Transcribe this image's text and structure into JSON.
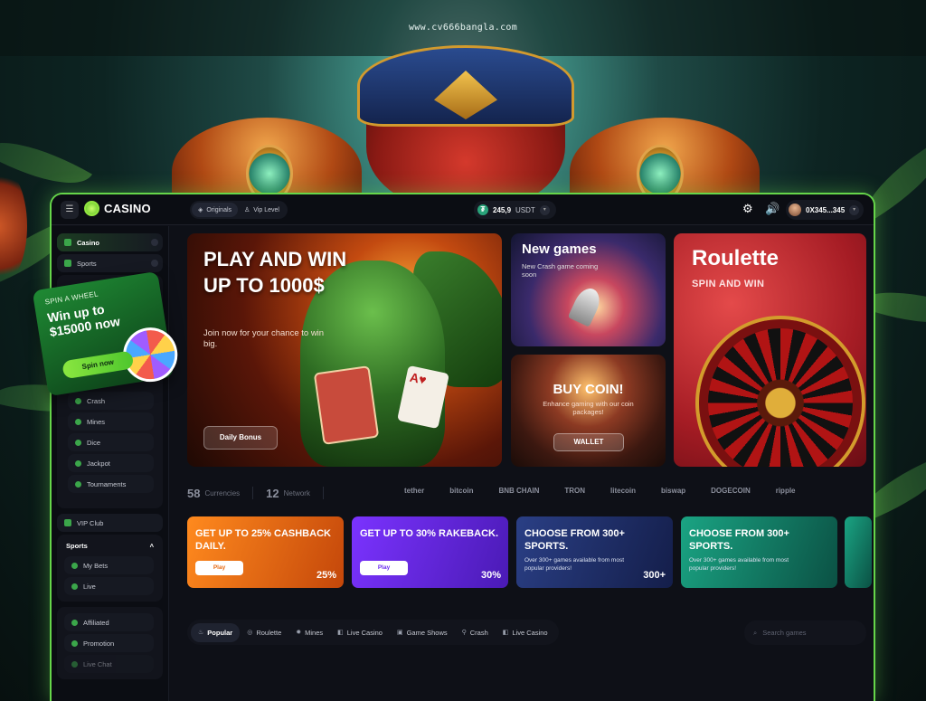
{
  "site_url": "www.cv666bangla.com",
  "brand": {
    "logo_text": "CASINO",
    "accent_color": "#66d64a"
  },
  "header": {
    "pills": [
      {
        "label": "Originals",
        "icon": "originals-icon"
      },
      {
        "label": "Vip Level",
        "icon": "vip-icon"
      }
    ],
    "balance": {
      "amount": "245,9",
      "unit": "USDT",
      "currency_icon": "tether-icon"
    },
    "wallet_address": "0X345...345"
  },
  "sidebar": {
    "top_items": [
      {
        "label": "Casino"
      },
      {
        "label": "Sports"
      }
    ],
    "games": [
      {
        "label": "Crash"
      },
      {
        "label": "Mines"
      },
      {
        "label": "Dice"
      },
      {
        "label": "Jackpot"
      },
      {
        "label": "Tournaments"
      }
    ],
    "vip": {
      "label": "VIP Club"
    },
    "sports_group": {
      "heading": "Sports",
      "items": [
        {
          "label": "My Bets"
        },
        {
          "label": "Live"
        }
      ]
    },
    "bottom_items": [
      {
        "label": "Affiliated"
      },
      {
        "label": "Promotion"
      },
      {
        "label": "Live Chat"
      }
    ]
  },
  "spin_card": {
    "title": "SPIN A WHEEL",
    "amount_line1": "Win up to",
    "amount_line2": "$15000 now",
    "button": "Spin now"
  },
  "banners": {
    "main": {
      "title": "PLAY AND WIN UP TO 1000$",
      "subtitle": "Join now for your chance to win big.",
      "button": "Daily Bonus"
    },
    "new_games": {
      "title": "New games",
      "subtitle": "New Crash game coming soon"
    },
    "buy_coin": {
      "title": "BUY COIN!",
      "subtitle": "Enhance gaming with our coin packages!",
      "button": "WALLET"
    },
    "roulette": {
      "title": "Roulette",
      "subtitle": "SPIN AND WIN"
    }
  },
  "stats": {
    "currencies_count": "58",
    "currencies_label": "Currencies",
    "network_count": "12",
    "network_label": "Network",
    "coins": [
      "tether",
      "bitcoin",
      "BNB CHAIN",
      "TRON",
      "litecoin",
      "biswap",
      "DOGECOIN",
      "ripple"
    ]
  },
  "promos": [
    {
      "title": "GET UP TO 25% CASHBACK DAILY.",
      "button": "Play",
      "value": "25%"
    },
    {
      "title": "GET UP TO 30% RAKEBACK.",
      "button": "Play",
      "value": "30%"
    },
    {
      "title": "CHOOSE FROM 300+ SPORTS.",
      "desc": "Over 300+ games available from most popular providers!",
      "value": "300+"
    },
    {
      "title": "CHOOSE FROM 300+ SPORTS.",
      "desc": "Over 300+ games available from most popular providers!"
    }
  ],
  "tabs": [
    {
      "label": "Popular",
      "icon": "flame-icon"
    },
    {
      "label": "Roulette",
      "icon": "roulette-icon"
    },
    {
      "label": "Mines",
      "icon": "mines-icon"
    },
    {
      "label": "Live Casino",
      "icon": "live-casino-icon"
    },
    {
      "label": "Game Shows",
      "icon": "game-shows-icon"
    },
    {
      "label": "Crash",
      "icon": "crash-icon"
    },
    {
      "label": "Live Casino",
      "icon": "live-casino-icon"
    }
  ],
  "search": {
    "placeholder": "Search games"
  }
}
